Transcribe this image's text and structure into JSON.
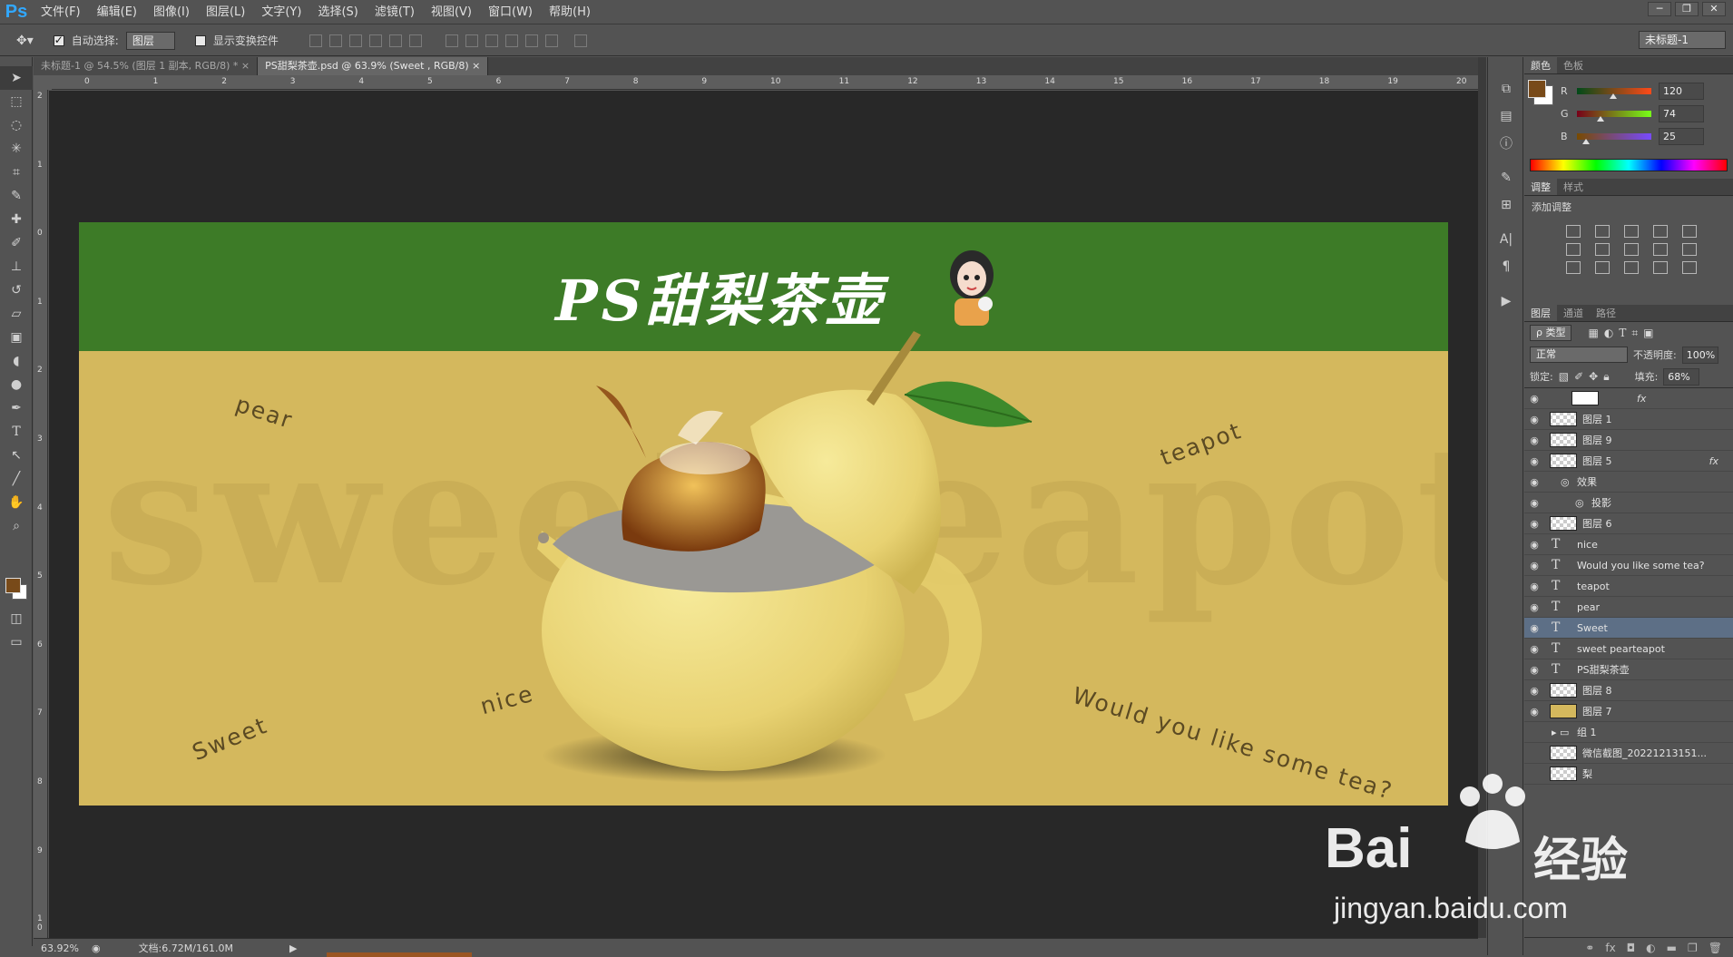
{
  "app": {
    "logo": "Ps",
    "menu": [
      "文件(F)",
      "编辑(E)",
      "图像(I)",
      "图层(L)",
      "文字(Y)",
      "选择(S)",
      "滤镜(T)",
      "视图(V)",
      "窗口(W)",
      "帮助(H)"
    ],
    "window_buttons": [
      "─",
      "❐",
      "✕"
    ]
  },
  "options": {
    "auto_select_label": "自动选择:",
    "auto_select_value": "图层",
    "show_transform_label": "显示变换控件",
    "workspace": "未标题-1"
  },
  "tabs": [
    {
      "label": "未标题-1 @ 54.5% (图层 1 副本, RGB/8) *",
      "active": false
    },
    {
      "label": "PS甜梨茶壶.psd @ 63.9% (Sweet       , RGB/8)",
      "active": true
    }
  ],
  "ruler": {
    "h_ticks": [
      "0",
      "1",
      "2",
      "3",
      "4",
      "5",
      "6",
      "7",
      "8",
      "9",
      "10",
      "11",
      "12",
      "13",
      "14",
      "15",
      "16",
      "17",
      "18",
      "19",
      "20"
    ],
    "v_ticks": [
      "2",
      "1",
      "0",
      "1",
      "2",
      "3",
      "4",
      "5",
      "6",
      "7",
      "8",
      "9",
      "1 0"
    ]
  },
  "design": {
    "title": "PS甜梨茶壶",
    "bg_words": [
      "sweet",
      "teapot"
    ],
    "words": {
      "pear": "pear",
      "teapot": "teapot",
      "nice": "nice",
      "sweet": "Sweet",
      "question": "Would you like some tea?"
    },
    "colors": {
      "band": "#3d7b27",
      "background": "#d4b85d",
      "pear": "#ecd874"
    }
  },
  "status": {
    "zoom": "63.92%",
    "doc_size": "文档:6.72M/161.0M"
  },
  "color_panel": {
    "tabs": [
      "颜色",
      "色板"
    ],
    "fg_color": "#784a19",
    "r_label": "R",
    "r_value": "120",
    "g_label": "G",
    "g_value": "74",
    "b_label": "B",
    "b_value": "25"
  },
  "adjust_panel": {
    "tabs": [
      "调整",
      "样式"
    ],
    "heading": "添加调整"
  },
  "layers_panel": {
    "tabs": [
      "图层",
      "通道",
      "路径"
    ],
    "filter": "ρ 类型",
    "blend_mode": "正常",
    "opacity_label": "不透明度:",
    "opacity_value": "100%",
    "lock_label": "锁定:",
    "fill_label": "填充:",
    "fill_value": "68%",
    "layers": [
      {
        "name": "",
        "kind": "adjust",
        "visible": true,
        "fx": "fx"
      },
      {
        "name": "图层 1",
        "kind": "pixel",
        "visible": true
      },
      {
        "name": "图层 9",
        "kind": "pixel",
        "visible": true
      },
      {
        "name": "图层 5",
        "kind": "pixel",
        "visible": true,
        "fx": "fx"
      },
      {
        "name": "效果",
        "kind": "effect",
        "visible": true
      },
      {
        "name": "投影",
        "kind": "effect2",
        "visible": true
      },
      {
        "name": "图层 6",
        "kind": "pixel",
        "visible": true
      },
      {
        "name": "nice",
        "kind": "text",
        "visible": true
      },
      {
        "name": "Would you like some tea?",
        "kind": "text",
        "visible": true
      },
      {
        "name": "teapot",
        "kind": "text",
        "visible": true
      },
      {
        "name": "pear",
        "kind": "text",
        "visible": true
      },
      {
        "name": "Sweet",
        "kind": "text",
        "visible": true,
        "selected": true
      },
      {
        "name": "sweet pearteapot",
        "kind": "text",
        "visible": true
      },
      {
        "name": "PS甜梨茶壶",
        "kind": "text",
        "visible": true
      },
      {
        "name": "图层 8",
        "kind": "pixel",
        "visible": true
      },
      {
        "name": "图层 7",
        "kind": "fill",
        "visible": true
      },
      {
        "name": "组 1",
        "kind": "group",
        "visible": false
      },
      {
        "name": "微信截图_20221213151...",
        "kind": "pixel",
        "visible": false
      },
      {
        "name": "梨",
        "kind": "pixel",
        "visible": false
      }
    ]
  },
  "watermark": {
    "brand": "Bai",
    "brand_suffix": "经验",
    "url": "jingyan.baidu.com"
  }
}
